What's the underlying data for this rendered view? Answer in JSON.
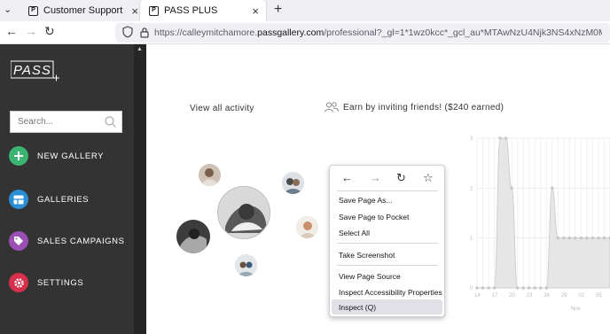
{
  "browser": {
    "tabs": [
      {
        "label": "Customer Support",
        "favicon": "P",
        "active": false
      },
      {
        "label": "PASS PLUS",
        "favicon": "P",
        "active": true
      }
    ],
    "url_prefix": "https://calleymitchamore.",
    "url_domain": "passgallery.com",
    "url_suffix": "/professional?_gl=1*1wz0kcc*_gcl_au*MTAwNzU4Njk3NS4xNzM0MTk4NzE2LjQ4NTM0"
  },
  "sidebar": {
    "logo_text": "PASS",
    "search_placeholder": "Search...",
    "items": [
      {
        "label": "NEW GALLERY",
        "color": "#3cb371",
        "icon": "plus-icon"
      },
      {
        "label": "GALLERIES",
        "color": "#2b8fd6",
        "icon": "grid-icon"
      },
      {
        "label": "SALES CAMPAIGNS",
        "color": "#9b4fb5",
        "icon": "tag-icon"
      },
      {
        "label": "SETTINGS",
        "color": "#d6304b",
        "icon": "gear-icon"
      }
    ]
  },
  "main": {
    "view_all": "View all activity",
    "earn": "Earn by inviting friends! ($240 earned)"
  },
  "context_menu": {
    "items": [
      {
        "label": "Save Page As..."
      },
      {
        "label": "Save Page to Pocket"
      },
      {
        "label": "Select All"
      },
      {
        "label": "Take Screenshot"
      },
      {
        "label": "View Page Source"
      },
      {
        "label": "Inspect Accessibility Properties"
      },
      {
        "label": "Inspect (Q)"
      }
    ]
  },
  "chart_data": {
    "type": "area",
    "x": [
      14,
      15,
      16,
      17,
      18,
      19,
      20,
      21,
      22,
      23,
      24,
      25,
      26,
      27,
      28,
      29,
      30,
      1,
      2,
      3,
      4,
      5,
      6,
      7
    ],
    "values": [
      0,
      0,
      0,
      0,
      3,
      3,
      2,
      0,
      0,
      0,
      0,
      0,
      0,
      2,
      1,
      1,
      1,
      1,
      1,
      1,
      1,
      1,
      1,
      1
    ],
    "xtick_labels": [
      "14",
      "17",
      "20",
      "23",
      "26",
      "29",
      "02",
      "05"
    ],
    "xtick_positions": [
      14,
      17,
      20,
      23,
      26,
      29,
      32,
      35
    ],
    "yticks": [
      "0",
      "1",
      "2",
      "3"
    ],
    "ylim": [
      0,
      3
    ],
    "xlabel": "Nov",
    "color": "#cccccc"
  }
}
